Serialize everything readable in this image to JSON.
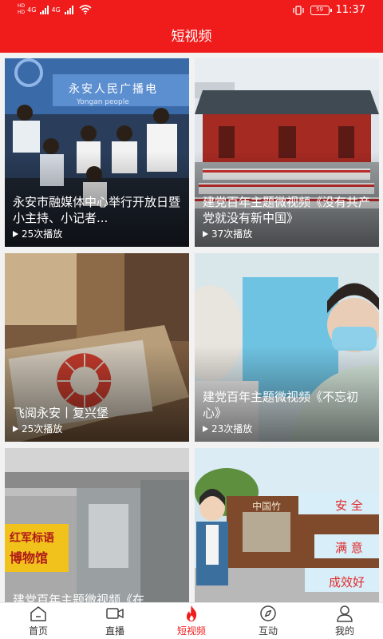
{
  "status_bar": {
    "network_top": "HD",
    "network_bottom": "HD",
    "signal1_label": "4G",
    "signal2_label": "4G",
    "battery": "59",
    "time": "11:37"
  },
  "header": {
    "title": "短视频"
  },
  "videos": [
    {
      "title": "永安市融媒体中心举行开放日暨小主持、小记者...",
      "plays": "25次播放"
    },
    {
      "title": "建党百年主题微视频《没有共产党就没有新中国》",
      "plays": "37次播放"
    },
    {
      "title": "飞阅永安丨复兴堡",
      "plays": "25次播放"
    },
    {
      "title": "建党百年主题微视频《不忘初心》",
      "plays": "23次播放"
    },
    {
      "title": "建党百年主题微视频《在",
      "plays": ""
    },
    {
      "title": "",
      "plays": ""
    }
  ],
  "thumb_text": {
    "v1_sign": "永安人民广播电",
    "v1_sign_sub": "Yongan people",
    "v5_sign1": "红军标语",
    "v5_sign2": "博物馆",
    "v6_sign_top": "中国竹",
    "v6_sign1": "安 全",
    "v6_sign2": "满 意",
    "v6_sign3": "成效好"
  },
  "tabbar": {
    "items": [
      {
        "label": "首页",
        "icon": "home-icon"
      },
      {
        "label": "直播",
        "icon": "video-camera-icon"
      },
      {
        "label": "短视频",
        "icon": "flame-icon",
        "active": true
      },
      {
        "label": "互动",
        "icon": "compass-icon"
      },
      {
        "label": "我的",
        "icon": "user-icon"
      }
    ]
  },
  "colors": {
    "brand": "#f01c1c",
    "tab_active": "#f01c1c"
  }
}
